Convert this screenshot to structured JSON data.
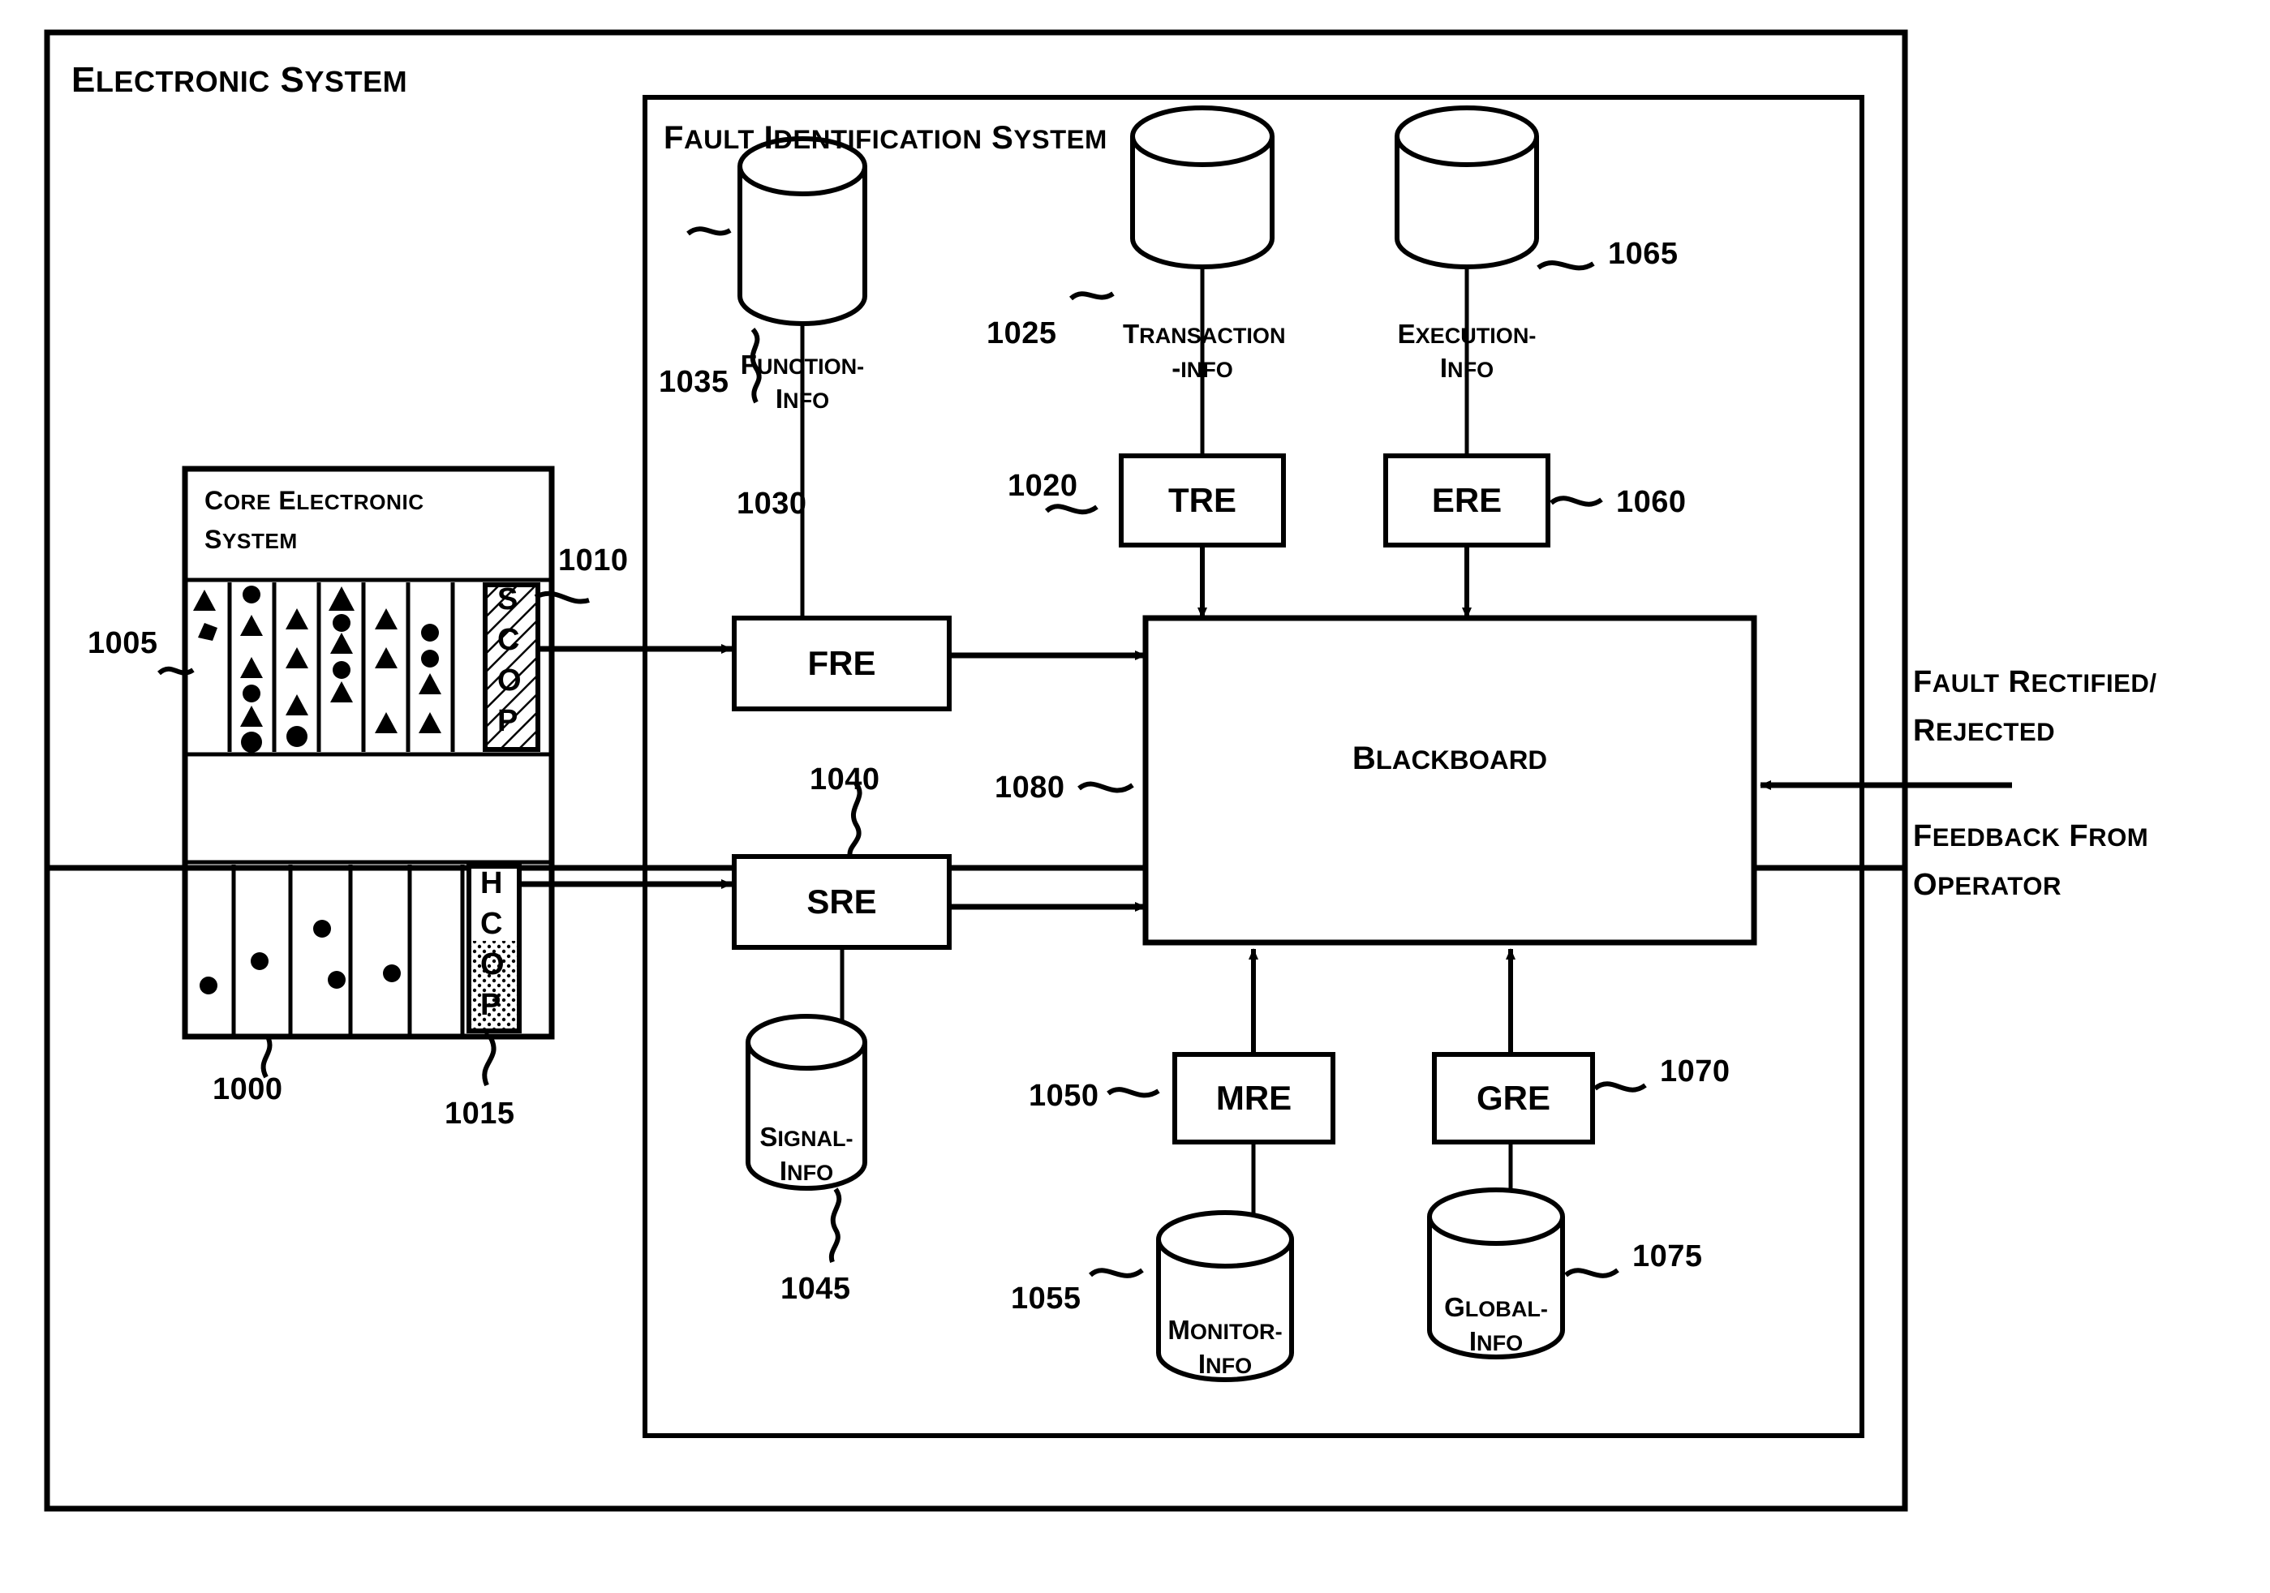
{
  "figure": {
    "outer_title": "Electronic System",
    "inner_title": "Fault Identification System",
    "core_title_line1": "Core electronic",
    "core_title_line2": "system"
  },
  "core_system": {
    "top_slot_label_letters": [
      "S",
      "C",
      "O",
      "P"
    ],
    "bottom_slot_label_letters": [
      "H",
      "C",
      "O",
      "P"
    ]
  },
  "boxes": {
    "fre": "FRE",
    "sre": "SRE",
    "tre": "TRE",
    "ere": "ERE",
    "mre": "MRE",
    "gre": "GRE",
    "blackboard": "Blackboard"
  },
  "databases": {
    "function_info": "Function-\nInfo",
    "transaction_info": "Transaction\n-Info",
    "execution_info": "Execution-\nInfo",
    "signal_info": "Signal-\nInfo",
    "monitor_info": "Monitor-\nInfo",
    "global_info": "Global-\nInfo"
  },
  "annotations": {
    "fault_rectified_line1": "Fault Rectified/",
    "fault_rectified_line2": "Rejected",
    "feedback_line1": "Feedback from",
    "feedback_line2": "Operator"
  },
  "reference_numerals": {
    "n1000": "1000",
    "n1005": "1005",
    "n1010": "1010",
    "n1015": "1015",
    "n1020": "1020",
    "n1025": "1025",
    "n1030": "1030",
    "n1035": "1035",
    "n1040": "1040",
    "n1045": "1045",
    "n1050": "1050",
    "n1055": "1055",
    "n1060": "1060",
    "n1065": "1065",
    "n1070": "1070",
    "n1075": "1075",
    "n1080": "1080"
  },
  "colors": {
    "ink": "#000000",
    "paper": "#ffffff"
  }
}
